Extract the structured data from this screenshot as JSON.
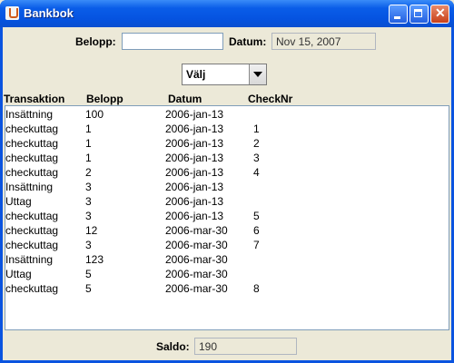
{
  "window": {
    "title": "Bankbok"
  },
  "form": {
    "belopp_label": "Belopp:",
    "belopp_value": "",
    "datum_label": "Datum:",
    "datum_value": "Nov 15, 2007",
    "filter_selected": "Välj"
  },
  "table": {
    "headers": [
      "Transaktion",
      "Belopp",
      "Datum",
      "CheckNr"
    ],
    "rows": [
      [
        "Insättning",
        "100",
        "2006-jan-13",
        ""
      ],
      [
        "checkuttag",
        "1",
        "2006-jan-13",
        "1"
      ],
      [
        "checkuttag",
        "1",
        "2006-jan-13",
        "2"
      ],
      [
        "checkuttag",
        "1",
        "2006-jan-13",
        "3"
      ],
      [
        "checkuttag",
        "2",
        "2006-jan-13",
        "4"
      ],
      [
        "Insättning",
        "3",
        "2006-jan-13",
        ""
      ],
      [
        "Uttag",
        "3",
        "2006-jan-13",
        ""
      ],
      [
        "checkuttag",
        "3",
        "2006-jan-13",
        "5"
      ],
      [
        "checkuttag",
        "12",
        "2006-mar-30",
        "6"
      ],
      [
        "checkuttag",
        "3",
        "2006-mar-30",
        "7"
      ],
      [
        "Insättning",
        "123",
        "2006-mar-30",
        ""
      ],
      [
        "Uttag",
        "5",
        "2006-mar-30",
        ""
      ],
      [
        "checkuttag",
        "5",
        "2006-mar-30",
        "8"
      ]
    ]
  },
  "footer": {
    "saldo_label": "Saldo:",
    "saldo_value": "190"
  }
}
